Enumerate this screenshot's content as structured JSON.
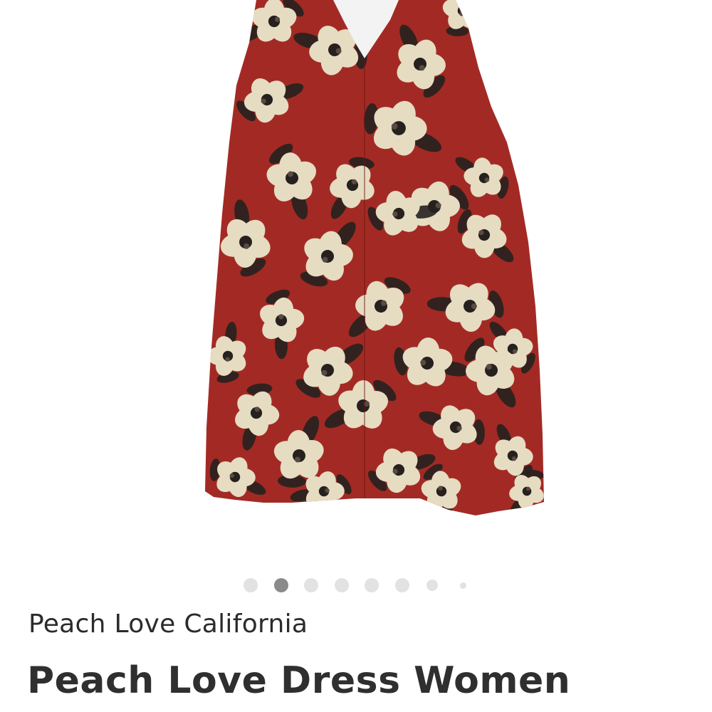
{
  "product": {
    "brand": "Peach Love California",
    "title": "Peach Love Dress Women",
    "image": {
      "subject": "red-floral-sleeveless-dress",
      "colors": {
        "fabric": "#a32a24",
        "flower": "#e6dcc2",
        "ink": "#26211f",
        "lining": "#f3f3f3"
      }
    }
  },
  "carousel": {
    "total": 8,
    "active_index": 1,
    "colors": {
      "active": "#8a8a8a",
      "inactive": "#e2e2e2"
    }
  }
}
